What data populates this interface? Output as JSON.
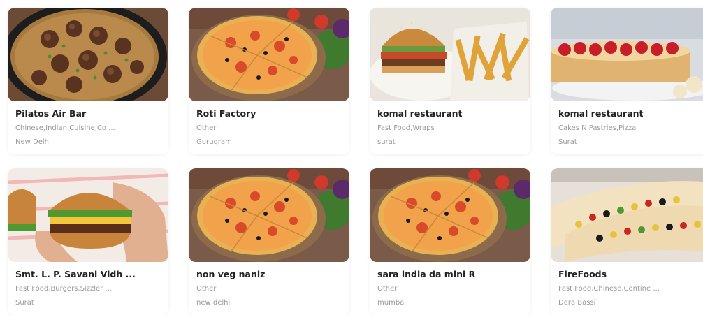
{
  "restaurants": [
    {
      "name": "Pilatos Air Bar",
      "cuisine": "Chinese,Indian Cuisine,Co ...",
      "city": "New Delhi",
      "image": "meatball-rice-icon"
    },
    {
      "name": "Roti Factory",
      "cuisine": "Other",
      "city": "Gurugram",
      "image": "pizza-icon"
    },
    {
      "name": "komal restaurant",
      "cuisine": "Fast Food,Wraps",
      "city": "surat",
      "image": "burger-fries-icon"
    },
    {
      "name": "komal restaurant",
      "cuisine": "Cakes N Pastries,Pizza",
      "city": "Surat",
      "image": "cake-icon"
    },
    {
      "name": "Smt. L. P. Savani Vidh ...",
      "cuisine": "Fast Food,Burgers,Sizzler ...",
      "city": "Surat",
      "image": "burger-hand-icon"
    },
    {
      "name": "non veg naniz",
      "cuisine": "Other",
      "city": "new delhi",
      "image": "pizza-icon"
    },
    {
      "name": "sara india da mini R",
      "cuisine": "Other",
      "city": "mumbai",
      "image": "pizza-icon"
    },
    {
      "name": "FireFoods",
      "cuisine": "Fast Food,Chinese,Contine ...",
      "city": "Dera Bassi",
      "image": "wrap-icon"
    }
  ]
}
